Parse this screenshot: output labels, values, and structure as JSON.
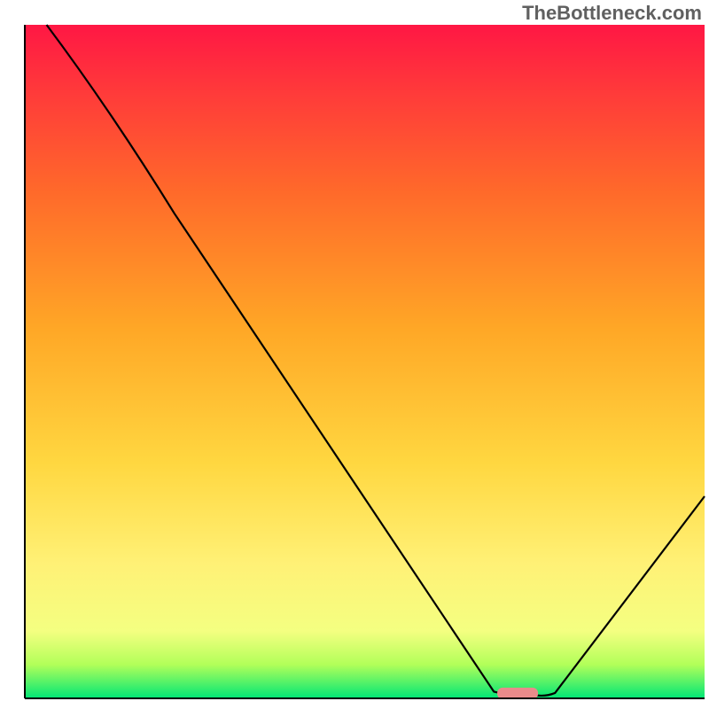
{
  "watermark": "TheBottleneck.com",
  "chart_data": {
    "type": "line",
    "title": "",
    "xlabel": "",
    "ylabel": "",
    "xlim": [
      0,
      100
    ],
    "ylim": [
      0,
      100
    ],
    "background": {
      "type": "vertical_gradient",
      "stops": [
        {
          "offset": 0.0,
          "color": "#ff1744"
        },
        {
          "offset": 0.1,
          "color": "#ff3a3a"
        },
        {
          "offset": 0.25,
          "color": "#ff6a2a"
        },
        {
          "offset": 0.45,
          "color": "#ffa726"
        },
        {
          "offset": 0.65,
          "color": "#ffd740"
        },
        {
          "offset": 0.8,
          "color": "#fff176"
        },
        {
          "offset": 0.9,
          "color": "#f4ff81"
        },
        {
          "offset": 0.95,
          "color": "#b2ff59"
        },
        {
          "offset": 1.0,
          "color": "#00e676"
        }
      ]
    },
    "curve": {
      "name": "bottleneck",
      "points": [
        {
          "x": 3.2,
          "y": 100
        },
        {
          "x": 22,
          "y": 72
        },
        {
          "x": 69,
          "y": 1.0
        },
        {
          "x": 75,
          "y": 0.5
        },
        {
          "x": 78,
          "y": 0.8
        },
        {
          "x": 100,
          "y": 30
        }
      ]
    },
    "marker": {
      "x": 72.5,
      "y": 0.8,
      "width": 6,
      "color": "#e98b8b"
    },
    "axes": {
      "color": "#000000",
      "width": 2
    }
  }
}
